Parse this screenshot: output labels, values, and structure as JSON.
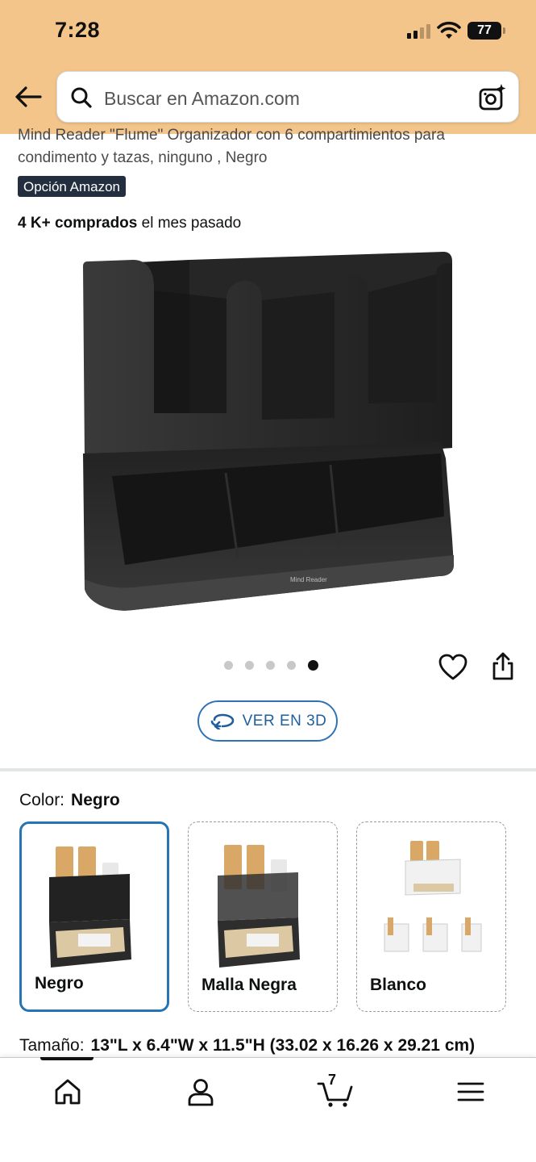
{
  "status_bar": {
    "time": "7:28",
    "battery": "77"
  },
  "search": {
    "placeholder": "Buscar en Amazon.com"
  },
  "product": {
    "title_line1": "Mind Reader \"Flume\" Organizador con 6 compartimientos para",
    "title_line2": "condimento y tazas, ninguno , Negro",
    "badge": "Opción Amazon",
    "bought_bold": "4 K+ comprados",
    "bought_rest": " el mes pasado",
    "image_text": "Mind Reader",
    "image_count": 5,
    "active_image": 5
  },
  "view_3d": {
    "label": "VER EN 3D"
  },
  "color": {
    "label": "Color:",
    "selected": "Negro",
    "options": [
      {
        "name": "Negro"
      },
      {
        "name": "Malla Negra"
      },
      {
        "name": "Blanco"
      }
    ]
  },
  "size": {
    "label": "Tamaño:",
    "value": "13\"L x 6.4\"W x 11.5\"H (33.02 x 16.26 x 29.21 cm)"
  },
  "nav": {
    "cart_count": "7"
  },
  "colors": {
    "header_bg": "#f4c58a",
    "accent_blue": "#2874b2",
    "badge_bg": "#232f3e"
  }
}
